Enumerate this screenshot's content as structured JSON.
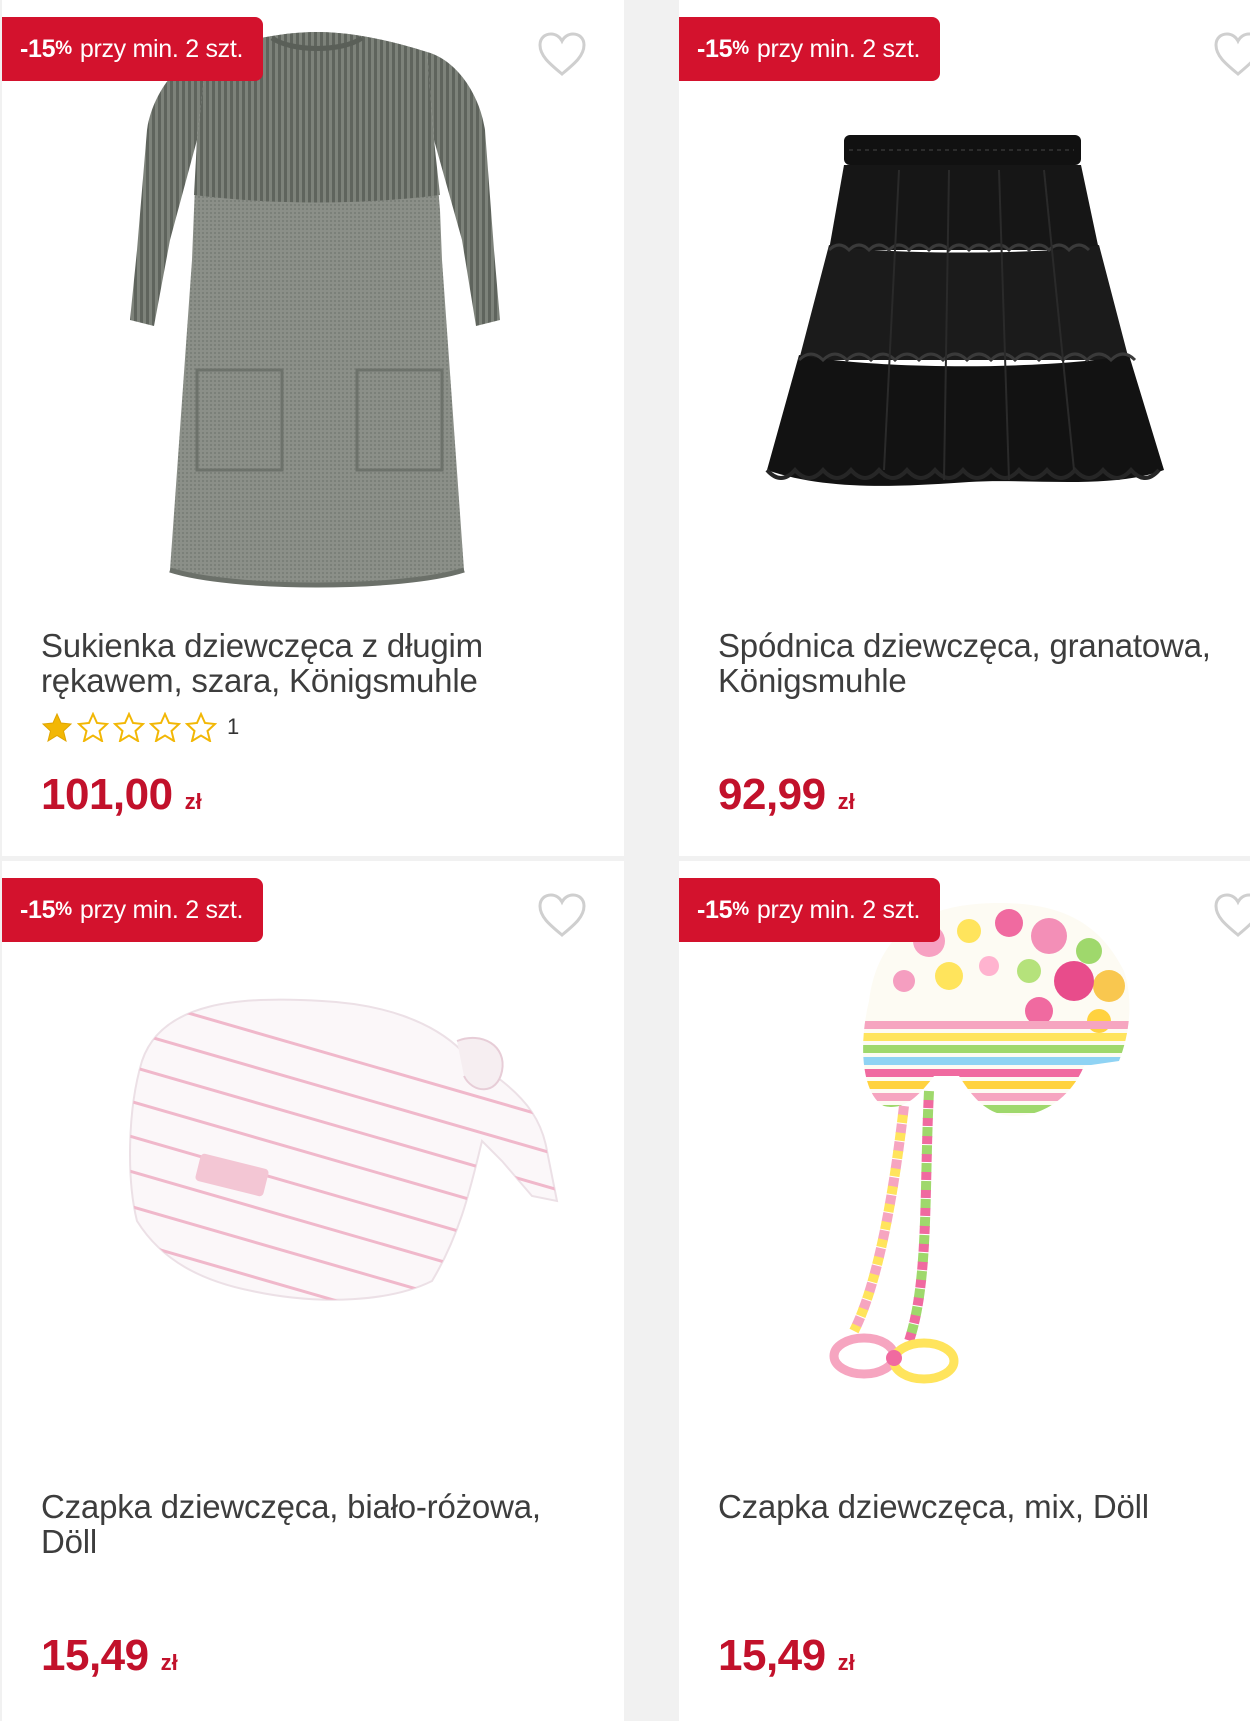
{
  "colors": {
    "accent_red": "#d3122d",
    "price_red": "#c2112b",
    "star_gold": "#f2b705",
    "background": "#f1f1f1"
  },
  "products": [
    {
      "badge": {
        "percent": "-15",
        "percent_sign": "%",
        "text": "przy min. 2 szt."
      },
      "title": "Sukienka dziewczęca z długim rękawem, szara, Königsmuhle",
      "rating": {
        "stars": 1,
        "max_stars": 5,
        "count": "1"
      },
      "price": {
        "value": "101,00",
        "currency": "zł"
      },
      "image": "grey-knit-dress",
      "favorite_icon": "heart-outline-icon"
    },
    {
      "badge": {
        "percent": "-15",
        "percent_sign": "%",
        "text": "przy min. 2 szt."
      },
      "title": "Spódnica dziewczęca, granatowa, Königsmuhle",
      "price": {
        "value": "92,99",
        "currency": "zł"
      },
      "image": "black-tulle-skirt",
      "favorite_icon": "heart-outline-icon"
    },
    {
      "badge": {
        "percent": "-15",
        "percent_sign": "%",
        "text": "przy min. 2 szt."
      },
      "title": "Czapka dziewczęca, biało-różowa, Döll",
      "price": {
        "value": "15,49",
        "currency": "zł"
      },
      "image": "white-pink-striped-beanie",
      "favorite_icon": "heart-outline-icon"
    },
    {
      "badge": {
        "percent": "-15",
        "percent_sign": "%",
        "text": "przy min. 2 szt."
      },
      "title": "Czapka dziewczęca, mix, Döll",
      "price": {
        "value": "15,49",
        "currency": "zł"
      },
      "image": "multicolor-dotted-tie-hat",
      "favorite_icon": "heart-outline-icon"
    }
  ]
}
